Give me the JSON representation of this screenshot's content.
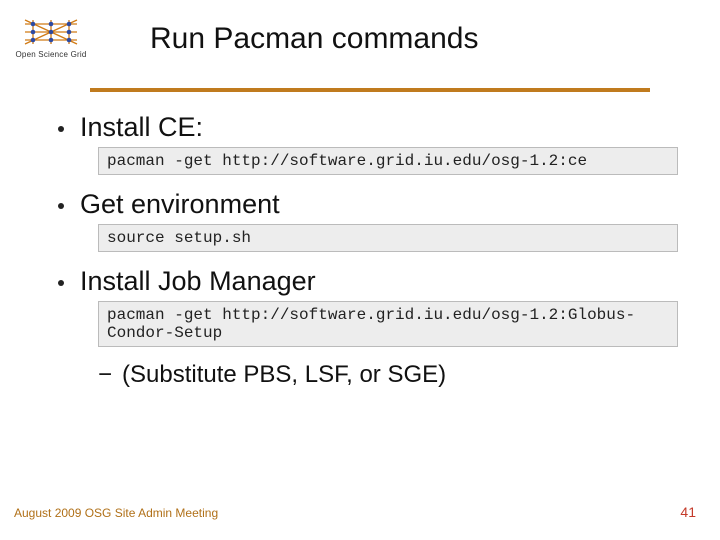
{
  "logo": {
    "label": "Open Science Grid"
  },
  "title": "Run Pacman commands",
  "bullets": [
    {
      "label": "Install CE:",
      "code": "pacman -get http://software.grid.iu.edu/osg-1.2:ce"
    },
    {
      "label": "Get environment",
      "code": "source setup.sh"
    },
    {
      "label": "Install Job Manager",
      "code": "pacman -get http://software.grid.iu.edu/osg-1.2:Globus-Condor-Setup",
      "sub": "(Substitute PBS, LSF, or SGE)"
    }
  ],
  "footer": {
    "left": "August 2009 OSG Site Admin Meeting",
    "right": "41"
  }
}
